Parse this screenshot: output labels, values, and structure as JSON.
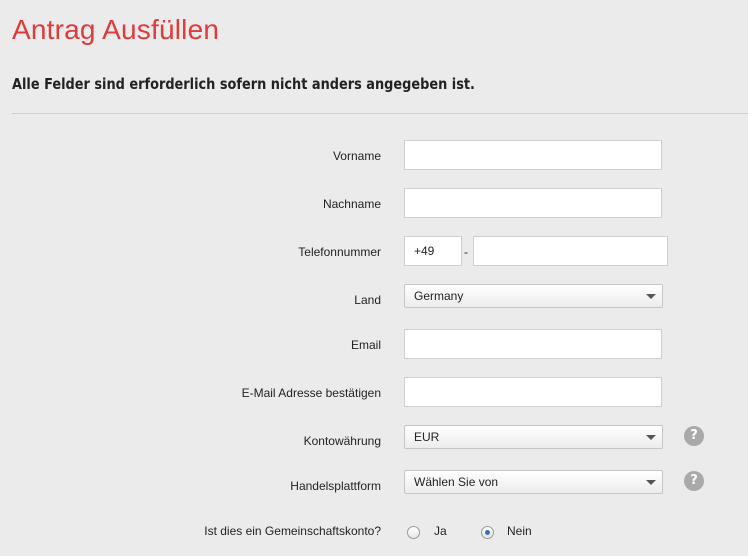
{
  "page": {
    "title": "Antrag Ausfüllen",
    "subtitle": "Alle Felder sind erforderlich sofern nicht anders angegeben ist."
  },
  "form": {
    "first_name": {
      "label": "Vorname",
      "value": ""
    },
    "last_name": {
      "label": "Nachname",
      "value": ""
    },
    "phone": {
      "label": "Telefonnummer",
      "country_code": "+49",
      "separator": "-",
      "value": ""
    },
    "country": {
      "label": "Land",
      "selected": "Germany"
    },
    "email": {
      "label": "Email",
      "value": ""
    },
    "email_confirm": {
      "label": "E-Mail Adresse bestätigen",
      "value": ""
    },
    "currency": {
      "label": "Kontowährung",
      "selected": "EUR",
      "help_icon": "question-mark-icon",
      "help_glyph": "?"
    },
    "platform": {
      "label": "Handelsplattform",
      "selected": "Wählen Sie von",
      "help_icon": "question-mark-icon",
      "help_glyph": "?"
    },
    "joint_account": {
      "label": "Ist dies ein Gemeinschaftskonto?",
      "options": [
        {
          "label": "Ja",
          "checked": false
        },
        {
          "label": "Nein",
          "checked": true
        }
      ]
    }
  },
  "colors": {
    "title": "#e03a3a",
    "background": "#ebebeb"
  }
}
